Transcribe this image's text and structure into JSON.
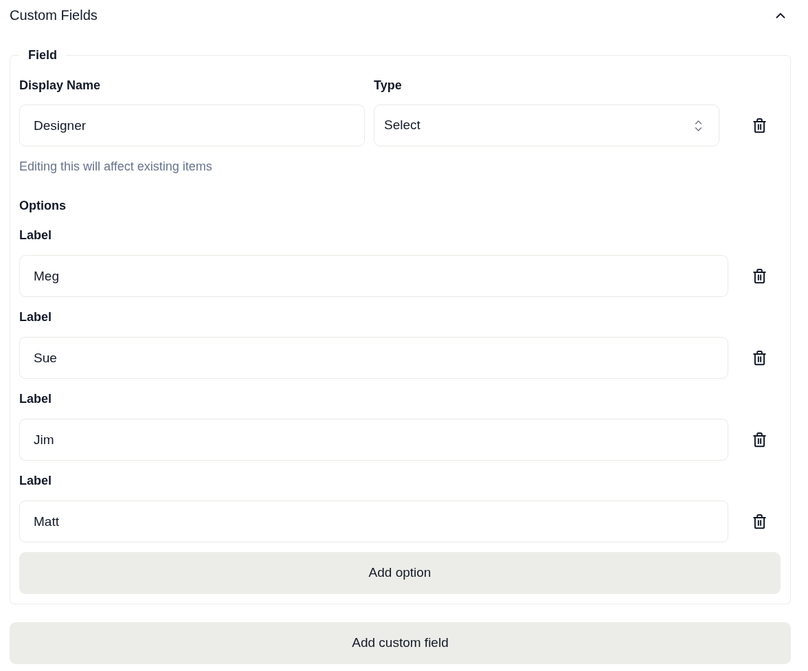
{
  "section": {
    "title": "Custom Fields",
    "expanded": true
  },
  "fields": [
    {
      "legend": "Field",
      "display_name": {
        "label": "Display Name",
        "value": "Designer"
      },
      "type": {
        "label": "Type",
        "value": "Select"
      },
      "help_text": "Editing this will affect existing items",
      "options_heading": "Options",
      "options": [
        {
          "label": "Label",
          "value": "Meg"
        },
        {
          "label": "Label",
          "value": "Sue"
        },
        {
          "label": "Label",
          "value": "Jim"
        },
        {
          "label": "Label",
          "value": "Matt"
        }
      ],
      "add_option_button": "Add option"
    }
  ],
  "add_custom_field_button": "Add custom field"
}
